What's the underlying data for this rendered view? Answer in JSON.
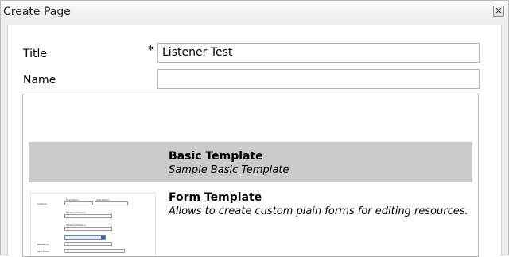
{
  "dialog": {
    "title": "Create Page",
    "close_glyph": "×"
  },
  "form": {
    "title_label": "Title",
    "required_marker": "*",
    "title_value": "Listener Test",
    "name_label": "Name",
    "name_value": ""
  },
  "templates": [
    {
      "name": "Basic Template",
      "description": "Sample Basic Template",
      "selected": true
    },
    {
      "name": "Form Template",
      "description": "Allows to create custom plain forms for editing resources.",
      "selected": false
    }
  ]
}
